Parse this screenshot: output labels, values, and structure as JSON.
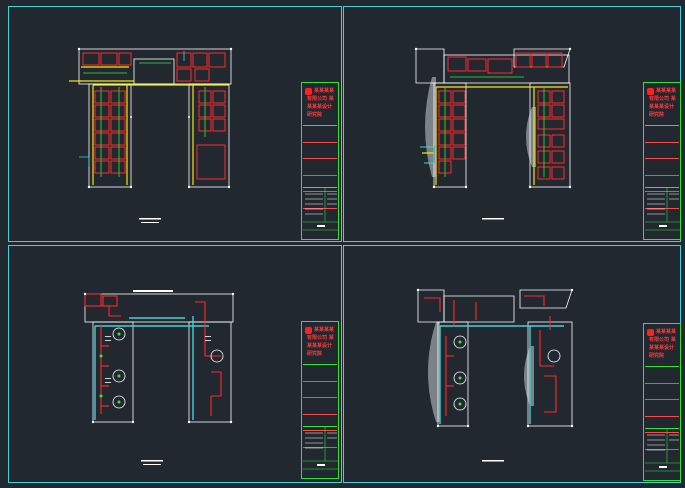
{
  "viewer": {
    "layout": "2x2 drawing sheets",
    "background": "#212830",
    "sheet_border_color": "#3fd2d6",
    "title_block_color": "#2ee62e",
    "accent_red": "#ff2020"
  },
  "sheets": [
    {
      "id": "top-left",
      "title_text": "某某某某有限公司 某某某某设计研究院",
      "type": "floor-plan"
    },
    {
      "id": "top-right",
      "title_text": "某某某某有限公司 某某某某设计研究院",
      "type": "floor-plan"
    },
    {
      "id": "bottom-left",
      "title_text": "某某某某有限公司 某某某某设计研究院",
      "type": "floor-plan"
    },
    {
      "id": "bottom-right",
      "title_text": "某某某某有限公司 某某某某设计研究院",
      "type": "floor-plan"
    }
  ],
  "icons": [
    "company-logo-icon"
  ]
}
